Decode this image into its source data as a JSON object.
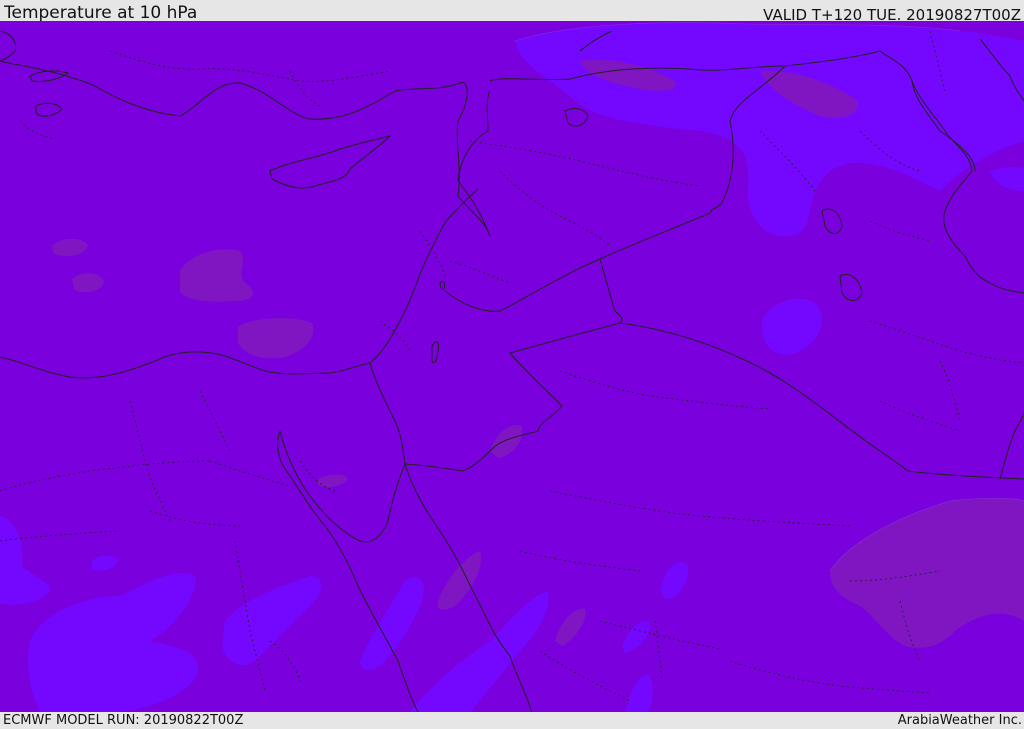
{
  "header": {
    "title": "Temperature at 10 hPa",
    "valid": "VALID T+120 TUE. 20190827T00Z"
  },
  "footer": {
    "model_run": "ECMWF MODEL RUN: 20190822T00Z",
    "credit": "ArabiaWeather Inc."
  },
  "colors": {
    "base_fill": "#7a00dd",
    "warm_band": "#7f16c2",
    "cool_band": "#7408ff",
    "lines": "#222222"
  }
}
